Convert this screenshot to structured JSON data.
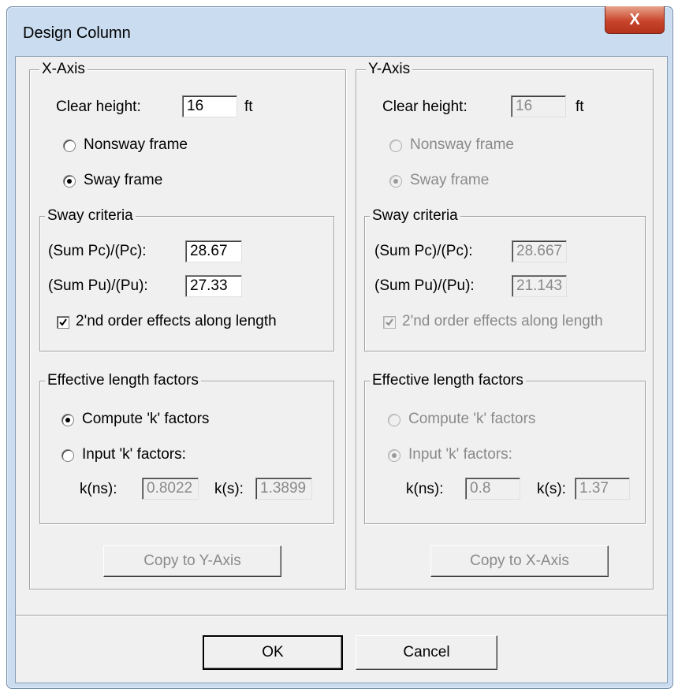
{
  "window": {
    "title": "Design Column",
    "close_glyph": "X"
  },
  "x_axis": {
    "legend": "X-Axis",
    "clear_height_label": "Clear height:",
    "clear_height_value": "16",
    "clear_height_unit": "ft",
    "nonsway_label": "Nonsway frame",
    "sway_label": "Sway frame",
    "frame_selected": "sway",
    "sway_criteria": {
      "legend": "Sway criteria",
      "sum_pc_label": "(Sum Pc)/(Pc):",
      "sum_pc_value": "28.67",
      "sum_pu_label": "(Sum Pu)/(Pu):",
      "sum_pu_value": "27.33",
      "second_order_label": "2'nd order effects along length",
      "second_order_checked": true
    },
    "effective_length": {
      "legend": "Effective length factors",
      "compute_label": "Compute 'k' factors",
      "input_label": "Input 'k' factors:",
      "selected": "compute",
      "kns_label": "k(ns):",
      "kns_value": "0.8022",
      "ks_label": "k(s):",
      "ks_value": "1.3899"
    },
    "copy_button": "Copy to Y-Axis"
  },
  "y_axis": {
    "legend": "Y-Axis",
    "clear_height_label": "Clear height:",
    "clear_height_value": "16",
    "clear_height_unit": "ft",
    "nonsway_label": "Nonsway frame",
    "sway_label": "Sway frame",
    "frame_selected": "sway",
    "sway_criteria": {
      "legend": "Sway criteria",
      "sum_pc_label": "(Sum Pc)/(Pc):",
      "sum_pc_value": "28.667",
      "sum_pu_label": "(Sum Pu)/(Pu):",
      "sum_pu_value": "21.143",
      "second_order_label": "2'nd order effects along length",
      "second_order_checked": true
    },
    "effective_length": {
      "legend": "Effective length factors",
      "compute_label": "Compute 'k' factors",
      "input_label": "Input 'k' factors:",
      "selected": "input",
      "kns_label": "k(ns):",
      "kns_value": "0.8",
      "ks_label": "k(s):",
      "ks_value": "1.37"
    },
    "copy_button": "Copy to X-Axis"
  },
  "footer": {
    "ok_label": "OK",
    "cancel_label": "Cancel"
  },
  "colors": {
    "title_bar": "#c9dcf0",
    "close_button": "#c8452c",
    "dialog_bg": "#f0f0f0",
    "disabled_text": "#8a8a8a"
  }
}
